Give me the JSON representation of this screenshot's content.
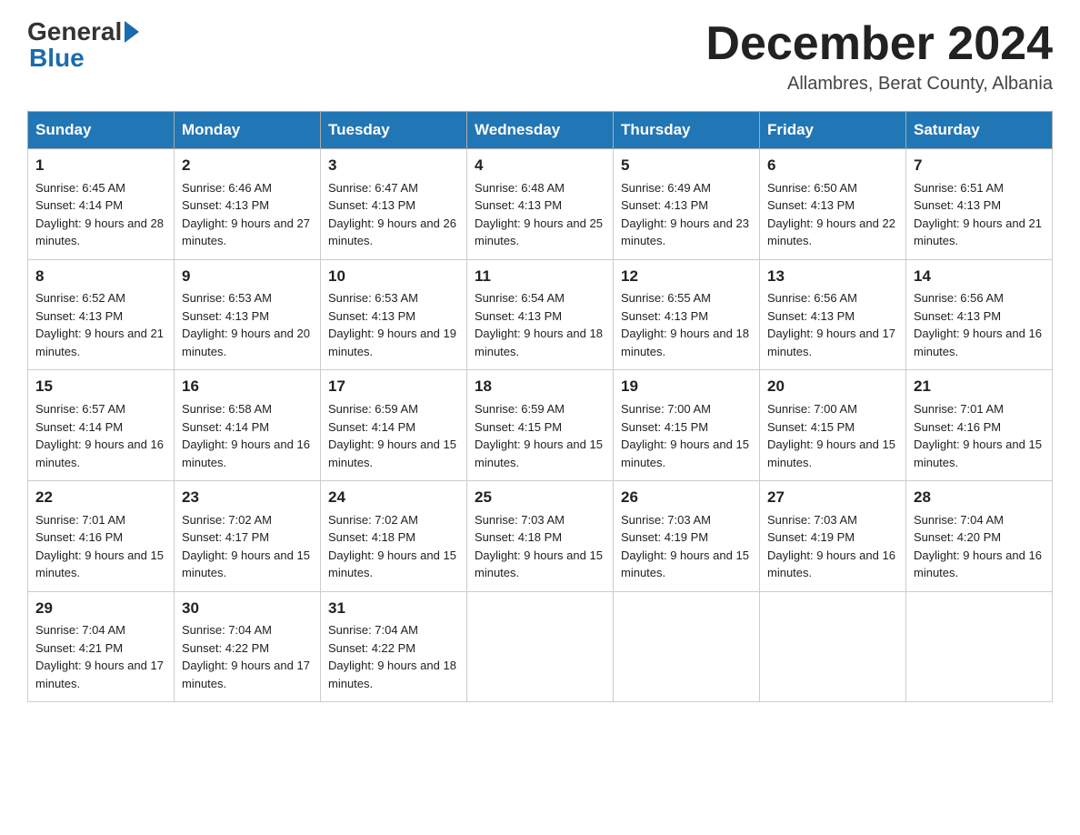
{
  "header": {
    "month_title": "December 2024",
    "subtitle": "Allambres, Berat County, Albania",
    "logo_general": "General",
    "logo_blue": "Blue"
  },
  "days_of_week": [
    "Sunday",
    "Monday",
    "Tuesday",
    "Wednesday",
    "Thursday",
    "Friday",
    "Saturday"
  ],
  "weeks": [
    [
      {
        "day": "1",
        "sunrise": "Sunrise: 6:45 AM",
        "sunset": "Sunset: 4:14 PM",
        "daylight": "Daylight: 9 hours and 28 minutes."
      },
      {
        "day": "2",
        "sunrise": "Sunrise: 6:46 AM",
        "sunset": "Sunset: 4:13 PM",
        "daylight": "Daylight: 9 hours and 27 minutes."
      },
      {
        "day": "3",
        "sunrise": "Sunrise: 6:47 AM",
        "sunset": "Sunset: 4:13 PM",
        "daylight": "Daylight: 9 hours and 26 minutes."
      },
      {
        "day": "4",
        "sunrise": "Sunrise: 6:48 AM",
        "sunset": "Sunset: 4:13 PM",
        "daylight": "Daylight: 9 hours and 25 minutes."
      },
      {
        "day": "5",
        "sunrise": "Sunrise: 6:49 AM",
        "sunset": "Sunset: 4:13 PM",
        "daylight": "Daylight: 9 hours and 23 minutes."
      },
      {
        "day": "6",
        "sunrise": "Sunrise: 6:50 AM",
        "sunset": "Sunset: 4:13 PM",
        "daylight": "Daylight: 9 hours and 22 minutes."
      },
      {
        "day": "7",
        "sunrise": "Sunrise: 6:51 AM",
        "sunset": "Sunset: 4:13 PM",
        "daylight": "Daylight: 9 hours and 21 minutes."
      }
    ],
    [
      {
        "day": "8",
        "sunrise": "Sunrise: 6:52 AM",
        "sunset": "Sunset: 4:13 PM",
        "daylight": "Daylight: 9 hours and 21 minutes."
      },
      {
        "day": "9",
        "sunrise": "Sunrise: 6:53 AM",
        "sunset": "Sunset: 4:13 PM",
        "daylight": "Daylight: 9 hours and 20 minutes."
      },
      {
        "day": "10",
        "sunrise": "Sunrise: 6:53 AM",
        "sunset": "Sunset: 4:13 PM",
        "daylight": "Daylight: 9 hours and 19 minutes."
      },
      {
        "day": "11",
        "sunrise": "Sunrise: 6:54 AM",
        "sunset": "Sunset: 4:13 PM",
        "daylight": "Daylight: 9 hours and 18 minutes."
      },
      {
        "day": "12",
        "sunrise": "Sunrise: 6:55 AM",
        "sunset": "Sunset: 4:13 PM",
        "daylight": "Daylight: 9 hours and 18 minutes."
      },
      {
        "day": "13",
        "sunrise": "Sunrise: 6:56 AM",
        "sunset": "Sunset: 4:13 PM",
        "daylight": "Daylight: 9 hours and 17 minutes."
      },
      {
        "day": "14",
        "sunrise": "Sunrise: 6:56 AM",
        "sunset": "Sunset: 4:13 PM",
        "daylight": "Daylight: 9 hours and 16 minutes."
      }
    ],
    [
      {
        "day": "15",
        "sunrise": "Sunrise: 6:57 AM",
        "sunset": "Sunset: 4:14 PM",
        "daylight": "Daylight: 9 hours and 16 minutes."
      },
      {
        "day": "16",
        "sunrise": "Sunrise: 6:58 AM",
        "sunset": "Sunset: 4:14 PM",
        "daylight": "Daylight: 9 hours and 16 minutes."
      },
      {
        "day": "17",
        "sunrise": "Sunrise: 6:59 AM",
        "sunset": "Sunset: 4:14 PM",
        "daylight": "Daylight: 9 hours and 15 minutes."
      },
      {
        "day": "18",
        "sunrise": "Sunrise: 6:59 AM",
        "sunset": "Sunset: 4:15 PM",
        "daylight": "Daylight: 9 hours and 15 minutes."
      },
      {
        "day": "19",
        "sunrise": "Sunrise: 7:00 AM",
        "sunset": "Sunset: 4:15 PM",
        "daylight": "Daylight: 9 hours and 15 minutes."
      },
      {
        "day": "20",
        "sunrise": "Sunrise: 7:00 AM",
        "sunset": "Sunset: 4:15 PM",
        "daylight": "Daylight: 9 hours and 15 minutes."
      },
      {
        "day": "21",
        "sunrise": "Sunrise: 7:01 AM",
        "sunset": "Sunset: 4:16 PM",
        "daylight": "Daylight: 9 hours and 15 minutes."
      }
    ],
    [
      {
        "day": "22",
        "sunrise": "Sunrise: 7:01 AM",
        "sunset": "Sunset: 4:16 PM",
        "daylight": "Daylight: 9 hours and 15 minutes."
      },
      {
        "day": "23",
        "sunrise": "Sunrise: 7:02 AM",
        "sunset": "Sunset: 4:17 PM",
        "daylight": "Daylight: 9 hours and 15 minutes."
      },
      {
        "day": "24",
        "sunrise": "Sunrise: 7:02 AM",
        "sunset": "Sunset: 4:18 PM",
        "daylight": "Daylight: 9 hours and 15 minutes."
      },
      {
        "day": "25",
        "sunrise": "Sunrise: 7:03 AM",
        "sunset": "Sunset: 4:18 PM",
        "daylight": "Daylight: 9 hours and 15 minutes."
      },
      {
        "day": "26",
        "sunrise": "Sunrise: 7:03 AM",
        "sunset": "Sunset: 4:19 PM",
        "daylight": "Daylight: 9 hours and 15 minutes."
      },
      {
        "day": "27",
        "sunrise": "Sunrise: 7:03 AM",
        "sunset": "Sunset: 4:19 PM",
        "daylight": "Daylight: 9 hours and 16 minutes."
      },
      {
        "day": "28",
        "sunrise": "Sunrise: 7:04 AM",
        "sunset": "Sunset: 4:20 PM",
        "daylight": "Daylight: 9 hours and 16 minutes."
      }
    ],
    [
      {
        "day": "29",
        "sunrise": "Sunrise: 7:04 AM",
        "sunset": "Sunset: 4:21 PM",
        "daylight": "Daylight: 9 hours and 17 minutes."
      },
      {
        "day": "30",
        "sunrise": "Sunrise: 7:04 AM",
        "sunset": "Sunset: 4:22 PM",
        "daylight": "Daylight: 9 hours and 17 minutes."
      },
      {
        "day": "31",
        "sunrise": "Sunrise: 7:04 AM",
        "sunset": "Sunset: 4:22 PM",
        "daylight": "Daylight: 9 hours and 18 minutes."
      },
      {
        "day": "",
        "sunrise": "",
        "sunset": "",
        "daylight": ""
      },
      {
        "day": "",
        "sunrise": "",
        "sunset": "",
        "daylight": ""
      },
      {
        "day": "",
        "sunrise": "",
        "sunset": "",
        "daylight": ""
      },
      {
        "day": "",
        "sunrise": "",
        "sunset": "",
        "daylight": ""
      }
    ]
  ]
}
